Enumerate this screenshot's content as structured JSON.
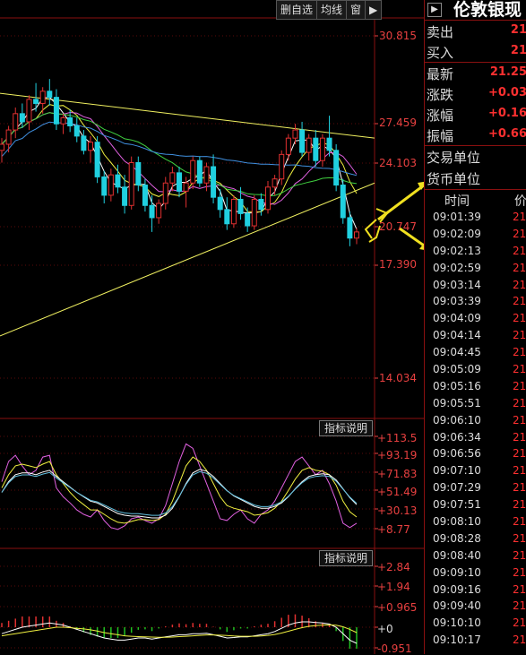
{
  "toolbar": {
    "items": [
      "删自选",
      "均线",
      "窗"
    ]
  },
  "main_chart": {
    "y_labels": [
      "30.815",
      "27.459",
      "24.103",
      "20.747",
      "17.390",
      "14.034"
    ],
    "y_ticks": [
      30.815,
      27.459,
      24.103,
      20.747,
      17.39,
      14.034
    ]
  },
  "indicator1": {
    "button": "指标说明",
    "y_labels": [
      "+113.5",
      "+93.19",
      "+71.83",
      "+51.49",
      "+30.13",
      "+8.77"
    ]
  },
  "indicator2": {
    "button": "指标说明",
    "y_labels": [
      "+2.84",
      "+1.94",
      "+0.965",
      "+0",
      "-0.951"
    ]
  },
  "side_panel": {
    "title": "伦敦银现",
    "quote": [
      {
        "label": "卖出",
        "value": "21"
      },
      {
        "label": "买入",
        "value": "21"
      },
      {
        "label": "最新",
        "value": "21.25"
      },
      {
        "label": "涨跌",
        "value": "+0.03"
      },
      {
        "label": "涨幅",
        "value": "+0.16"
      },
      {
        "label": "振幅",
        "value": "+0.66"
      }
    ],
    "units": [
      {
        "label": "交易单位"
      },
      {
        "label": "货币单位"
      }
    ],
    "ticks_header": {
      "time": "时间",
      "price": "价"
    },
    "ticks": [
      {
        "time": "09:01:39",
        "price": "21"
      },
      {
        "time": "09:02:09",
        "price": "21"
      },
      {
        "time": "09:02:13",
        "price": "21"
      },
      {
        "time": "09:02:59",
        "price": "21"
      },
      {
        "time": "09:03:14",
        "price": "21"
      },
      {
        "time": "09:03:39",
        "price": "21"
      },
      {
        "time": "09:04:09",
        "price": "21"
      },
      {
        "time": "09:04:14",
        "price": "21"
      },
      {
        "time": "09:04:45",
        "price": "21"
      },
      {
        "time": "09:05:09",
        "price": "21"
      },
      {
        "time": "09:05:16",
        "price": "21"
      },
      {
        "time": "09:05:51",
        "price": "21"
      },
      {
        "time": "09:06:10",
        "price": "21"
      },
      {
        "time": "09:06:34",
        "price": "21"
      },
      {
        "time": "09:06:56",
        "price": "21"
      },
      {
        "time": "09:07:10",
        "price": "21"
      },
      {
        "time": "09:07:29",
        "price": "21"
      },
      {
        "time": "09:07:51",
        "price": "21"
      },
      {
        "time": "09:08:10",
        "price": "21"
      },
      {
        "time": "09:08:28",
        "price": "21"
      },
      {
        "time": "09:08:40",
        "price": "21"
      },
      {
        "time": "09:09:10",
        "price": "21"
      },
      {
        "time": "09:09:16",
        "price": "21"
      },
      {
        "time": "09:09:40",
        "price": "21"
      },
      {
        "time": "09:10:10",
        "price": "21"
      },
      {
        "time": "09:10:17",
        "price": "21"
      }
    ]
  },
  "colors": {
    "up": "#e03030",
    "down": "#20d0e0",
    "trendline": "#f0f060",
    "ma_white": "#ffffff",
    "ma_yellow": "#f0f040",
    "ma_magenta": "#e060e0",
    "ma_green": "#40d040",
    "ma_blue": "#4090e0",
    "arrow": "#f0e020"
  },
  "candles": [
    {
      "o": 25.2,
      "h": 25.8,
      "l": 24.6,
      "c": 25.5
    },
    {
      "o": 25.5,
      "h": 26.4,
      "l": 25.1,
      "c": 26.2
    },
    {
      "o": 26.2,
      "h": 27.3,
      "l": 25.8,
      "c": 27.0
    },
    {
      "o": 27.0,
      "h": 27.5,
      "l": 26.3,
      "c": 26.6
    },
    {
      "o": 26.6,
      "h": 27.9,
      "l": 26.2,
      "c": 27.7
    },
    {
      "o": 27.7,
      "h": 28.5,
      "l": 27.1,
      "c": 27.5
    },
    {
      "o": 27.5,
      "h": 28.3,
      "l": 27.0,
      "c": 28.1
    },
    {
      "o": 28.1,
      "h": 28.7,
      "l": 27.4,
      "c": 27.8
    },
    {
      "o": 27.8,
      "h": 28.2,
      "l": 26.2,
      "c": 26.5
    },
    {
      "o": 26.5,
      "h": 27.0,
      "l": 26.0,
      "c": 26.8
    },
    {
      "o": 26.8,
      "h": 27.2,
      "l": 26.1,
      "c": 26.4
    },
    {
      "o": 26.4,
      "h": 26.8,
      "l": 25.6,
      "c": 25.9
    },
    {
      "o": 25.9,
      "h": 26.2,
      "l": 25.0,
      "c": 25.2
    },
    {
      "o": 25.2,
      "h": 25.9,
      "l": 24.6,
      "c": 25.6
    },
    {
      "o": 25.6,
      "h": 25.9,
      "l": 23.6,
      "c": 23.9
    },
    {
      "o": 23.9,
      "h": 24.2,
      "l": 22.6,
      "c": 23.0
    },
    {
      "o": 23.0,
      "h": 24.3,
      "l": 22.7,
      "c": 24.0
    },
    {
      "o": 24.0,
      "h": 24.5,
      "l": 23.1,
      "c": 23.4
    },
    {
      "o": 23.4,
      "h": 24.0,
      "l": 22.1,
      "c": 22.5
    },
    {
      "o": 22.5,
      "h": 24.9,
      "l": 22.3,
      "c": 24.6
    },
    {
      "o": 24.6,
      "h": 24.9,
      "l": 23.2,
      "c": 23.5
    },
    {
      "o": 23.5,
      "h": 23.8,
      "l": 22.2,
      "c": 22.5
    },
    {
      "o": 22.5,
      "h": 23.0,
      "l": 21.2,
      "c": 21.9
    },
    {
      "o": 21.9,
      "h": 22.8,
      "l": 21.6,
      "c": 22.6
    },
    {
      "o": 22.6,
      "h": 23.9,
      "l": 22.3,
      "c": 23.6
    },
    {
      "o": 23.6,
      "h": 24.4,
      "l": 23.2,
      "c": 24.1
    },
    {
      "o": 24.1,
      "h": 24.4,
      "l": 22.9,
      "c": 23.2
    },
    {
      "o": 23.2,
      "h": 23.9,
      "l": 22.4,
      "c": 23.6
    },
    {
      "o": 23.6,
      "h": 24.9,
      "l": 23.3,
      "c": 24.7
    },
    {
      "o": 24.7,
      "h": 24.9,
      "l": 23.4,
      "c": 23.6
    },
    {
      "o": 23.6,
      "h": 24.6,
      "l": 23.2,
      "c": 24.4
    },
    {
      "o": 24.4,
      "h": 25.0,
      "l": 22.6,
      "c": 22.9
    },
    {
      "o": 22.9,
      "h": 23.3,
      "l": 21.9,
      "c": 22.3
    },
    {
      "o": 22.3,
      "h": 22.9,
      "l": 21.3,
      "c": 21.6
    },
    {
      "o": 21.6,
      "h": 23.0,
      "l": 21.4,
      "c": 22.8
    },
    {
      "o": 22.8,
      "h": 23.4,
      "l": 21.8,
      "c": 22.1
    },
    {
      "o": 22.1,
      "h": 22.4,
      "l": 21.2,
      "c": 21.5
    },
    {
      "o": 21.5,
      "h": 23.0,
      "l": 21.3,
      "c": 22.8
    },
    {
      "o": 22.8,
      "h": 23.1,
      "l": 22.0,
      "c": 22.3
    },
    {
      "o": 22.3,
      "h": 23.7,
      "l": 22.1,
      "c": 23.4
    },
    {
      "o": 23.4,
      "h": 24.0,
      "l": 23.0,
      "c": 23.8
    },
    {
      "o": 23.8,
      "h": 25.2,
      "l": 23.5,
      "c": 25.0
    },
    {
      "o": 25.0,
      "h": 26.0,
      "l": 24.7,
      "c": 25.8
    },
    {
      "o": 25.8,
      "h": 26.5,
      "l": 25.5,
      "c": 26.2
    },
    {
      "o": 26.2,
      "h": 26.6,
      "l": 24.9,
      "c": 25.1
    },
    {
      "o": 25.1,
      "h": 26.0,
      "l": 24.7,
      "c": 25.8
    },
    {
      "o": 25.8,
      "h": 26.2,
      "l": 24.4,
      "c": 24.7
    },
    {
      "o": 24.7,
      "h": 26.0,
      "l": 24.4,
      "c": 25.8
    },
    {
      "o": 25.8,
      "h": 26.9,
      "l": 24.9,
      "c": 25.2
    },
    {
      "o": 25.2,
      "h": 25.5,
      "l": 23.2,
      "c": 23.5
    },
    {
      "o": 23.5,
      "h": 23.8,
      "l": 21.6,
      "c": 21.9
    },
    {
      "o": 21.9,
      "h": 22.2,
      "l": 20.5,
      "c": 20.9
    },
    {
      "o": 20.9,
      "h": 21.4,
      "l": 20.6,
      "c": 21.2
    }
  ],
  "ind1": {
    "k": [
      62,
      85,
      92,
      80,
      70,
      75,
      90,
      92,
      55,
      45,
      38,
      30,
      25,
      22,
      30,
      18,
      10,
      8,
      12,
      20,
      22,
      18,
      15,
      20,
      35,
      60,
      85,
      105,
      100,
      80,
      60,
      40,
      20,
      18,
      25,
      30,
      20,
      15,
      25,
      30,
      40,
      55,
      70,
      85,
      90,
      80,
      70,
      75,
      60,
      40,
      15,
      10,
      15
    ],
    "d": [
      55,
      70,
      80,
      82,
      80,
      78,
      82,
      85,
      70,
      60,
      50,
      42,
      36,
      30,
      30,
      25,
      20,
      16,
      15,
      17,
      19,
      19,
      18,
      19,
      25,
      40,
      60,
      80,
      90,
      85,
      75,
      60,
      45,
      35,
      32,
      30,
      28,
      24,
      25,
      27,
      32,
      40,
      52,
      65,
      75,
      78,
      75,
      74,
      70,
      58,
      40,
      28,
      22
    ],
    "j": [
      50,
      62,
      70,
      72,
      72,
      70,
      73,
      75,
      68,
      62,
      56,
      50,
      45,
      40,
      38,
      34,
      30,
      26,
      24,
      23,
      23,
      22,
      21,
      21,
      24,
      32,
      45,
      60,
      72,
      76,
      74,
      68,
      60,
      52,
      46,
      42,
      38,
      34,
      32,
      32,
      34,
      38,
      45,
      54,
      62,
      68,
      70,
      71,
      70,
      64,
      54,
      44,
      36
    ]
  },
  "ind2": {
    "dif": [
      -0.3,
      -0.2,
      -0.1,
      0.0,
      0.05,
      0.1,
      0.15,
      0.2,
      0.15,
      0.1,
      0.0,
      -0.1,
      -0.2,
      -0.3,
      -0.4,
      -0.5,
      -0.55,
      -0.6,
      -0.6,
      -0.55,
      -0.5,
      -0.5,
      -0.55,
      -0.5,
      -0.45,
      -0.4,
      -0.35,
      -0.35,
      -0.3,
      -0.3,
      -0.28,
      -0.35,
      -0.42,
      -0.5,
      -0.48,
      -0.45,
      -0.45,
      -0.4,
      -0.35,
      -0.3,
      -0.2,
      -0.05,
      0.1,
      0.2,
      0.25,
      0.25,
      0.22,
      0.2,
      0.15,
      0.0,
      -0.3,
      -0.6,
      -0.75
    ],
    "dea": [
      -0.4,
      -0.35,
      -0.3,
      -0.25,
      -0.2,
      -0.15,
      -0.1,
      -0.05,
      0.0,
      0.0,
      -0.02,
      -0.05,
      -0.08,
      -0.12,
      -0.18,
      -0.25,
      -0.3,
      -0.35,
      -0.4,
      -0.42,
      -0.44,
      -0.45,
      -0.46,
      -0.47,
      -0.47,
      -0.46,
      -0.44,
      -0.42,
      -0.4,
      -0.38,
      -0.36,
      -0.36,
      -0.37,
      -0.39,
      -0.41,
      -0.42,
      -0.42,
      -0.42,
      -0.41,
      -0.38,
      -0.34,
      -0.27,
      -0.19,
      -0.1,
      -0.02,
      0.04,
      0.08,
      0.1,
      0.11,
      0.09,
      0.02,
      -0.1,
      -0.25
    ]
  }
}
